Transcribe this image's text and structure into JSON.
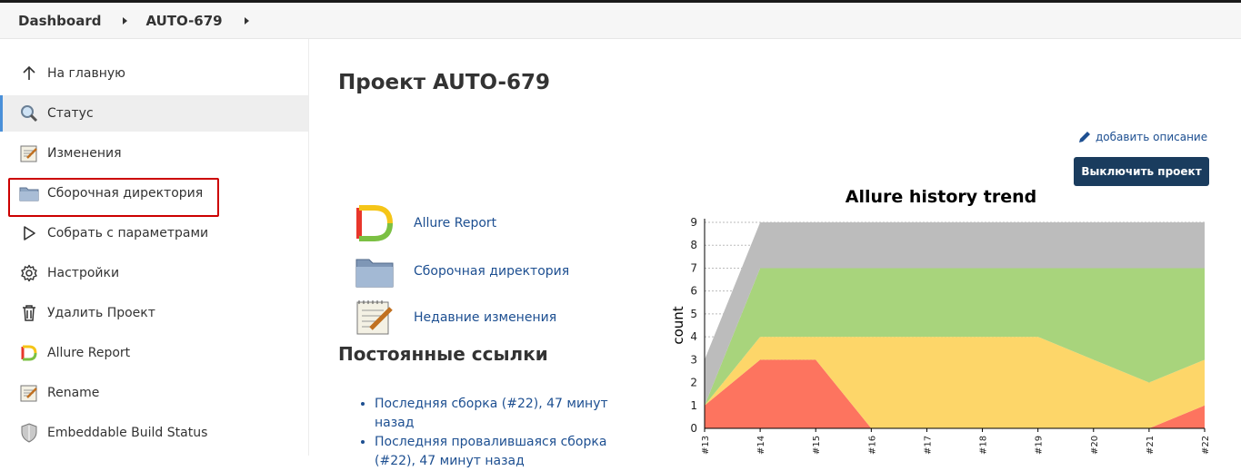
{
  "breadcrumb": {
    "items": [
      "Dashboard",
      "AUTO-679"
    ]
  },
  "sidebar": {
    "items": [
      {
        "label": "На главную",
        "icon": "arrow-up-icon"
      },
      {
        "label": "Статус",
        "icon": "magnifier-icon"
      },
      {
        "label": "Изменения",
        "icon": "notepad-icon"
      },
      {
        "label": "Сборочная директория",
        "icon": "folder-icon"
      },
      {
        "label": "Собрать с параметрами",
        "icon": "play-outline-icon"
      },
      {
        "label": "Настройки",
        "icon": "gear-icon"
      },
      {
        "label": "Удалить Проект",
        "icon": "trash-icon"
      },
      {
        "label": "Allure Report",
        "icon": "allure-icon"
      },
      {
        "label": "Rename",
        "icon": "notepad-icon"
      },
      {
        "label": "Embeddable Build Status",
        "icon": "shield-icon"
      }
    ],
    "active_index": 1,
    "highlighted_index": 4
  },
  "main": {
    "title": "Проект AUTO-679",
    "add_description": "добавить описание",
    "disable_button": "Выключить проект",
    "links": [
      {
        "label": "Allure Report",
        "icon": "allure-icon"
      },
      {
        "label": "Сборочная директория",
        "icon": "folder-icon"
      },
      {
        "label": "Недавние изменения",
        "icon": "notepad-icon"
      }
    ],
    "permalinks_title": "Постоянные ссылки",
    "permalinks": [
      "Последняя сборка (#22), 47 минут назад",
      "Последняя провалившаяся сборка (#22), 47 минут назад"
    ]
  },
  "colors": {
    "link": "#1d4f91",
    "button_bg": "#1a3c5e",
    "highlight": "#cc0000",
    "failed": "#fd745f",
    "broken": "#fdd669",
    "passed": "#a8d47c",
    "unknown": "#bcbcbc"
  },
  "chart_data": {
    "type": "area",
    "title": "Allure history trend",
    "ylabel": "count",
    "xlabel": "",
    "x": [
      "#13",
      "#14",
      "#15",
      "#16",
      "#17",
      "#18",
      "#19",
      "#20",
      "#21",
      "#22"
    ],
    "ylim": [
      0,
      9
    ],
    "yticks": [
      0,
      1,
      2,
      3,
      4,
      5,
      6,
      7,
      8,
      9
    ],
    "stacked": true,
    "grid": true,
    "series": [
      {
        "key": "failed",
        "values": [
          1,
          3,
          3,
          0,
          0,
          0,
          0,
          0,
          0,
          1
        ]
      },
      {
        "key": "broken",
        "values": [
          0,
          1,
          1,
          4,
          4,
          4,
          4,
          3,
          2,
          2
        ]
      },
      {
        "key": "passed",
        "values": [
          0,
          3,
          3,
          3,
          3,
          3,
          3,
          4,
          5,
          4
        ]
      },
      {
        "key": "unknown",
        "values": [
          2,
          2,
          2,
          2,
          2,
          2,
          2,
          2,
          2,
          2
        ]
      }
    ]
  }
}
